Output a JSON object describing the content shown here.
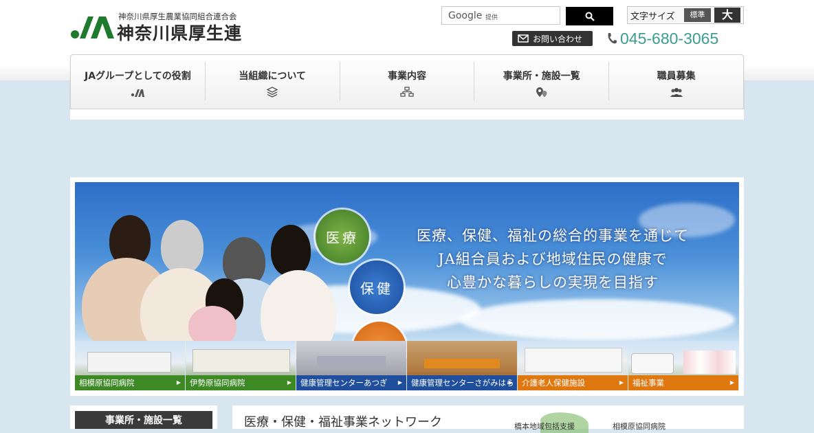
{
  "header": {
    "org_subtitle": "神奈川県厚生農業協同組合連合会",
    "org_name": "神奈川県厚生連",
    "search": {
      "brand": "Google",
      "provided": "提供"
    },
    "font_size": {
      "label": "文字サイズ",
      "standard": "標準",
      "large": "大"
    },
    "contact_label": "お問い合わせ",
    "phone": "045-680-3065"
  },
  "nav": {
    "items": [
      {
        "label": "JAグループとしての役割",
        "icon": "ja-logo-icon"
      },
      {
        "label": "当組織について",
        "icon": "layers-icon"
      },
      {
        "label": "事業内容",
        "icon": "org-chart-icon"
      },
      {
        "label": "事業所・施設一覧",
        "icon": "map-pin-icon"
      },
      {
        "label": "職員募集",
        "icon": "people-icon"
      }
    ]
  },
  "hero": {
    "badges": [
      "医療",
      "保健"
    ],
    "tagline": [
      "医療、保健、福祉の総合的事業を通じて",
      "JA組合員および地域住民の健康で",
      "心豊かな暮らしの実現を目指す"
    ],
    "thumbs": [
      {
        "label": "相模原協同病院",
        "color": "#3d8a25"
      },
      {
        "label": "伊勢原協同病院",
        "color": "#3d8a25"
      },
      {
        "label": "健康管理センターあつぎ",
        "color": "#1f4f9c"
      },
      {
        "label": "健康管理センターさがみはら",
        "color": "#1f4f9c"
      },
      {
        "label": "介護老人保健施設",
        "color": "#e07810"
      },
      {
        "label": "福祉事業",
        "color": "#e07810"
      }
    ]
  },
  "sidebar": {
    "title": "事業所・施設一覧"
  },
  "main": {
    "network_title": "医療・保健・福祉事業ネットワーク",
    "map_labels": [
      "橋本地域包括支援",
      "相模原協同病院"
    ]
  },
  "colors": {
    "accent_green": "#1f7a2e",
    "phone_teal": "#3b9e8c",
    "page_bg": "#d7e6ef"
  }
}
